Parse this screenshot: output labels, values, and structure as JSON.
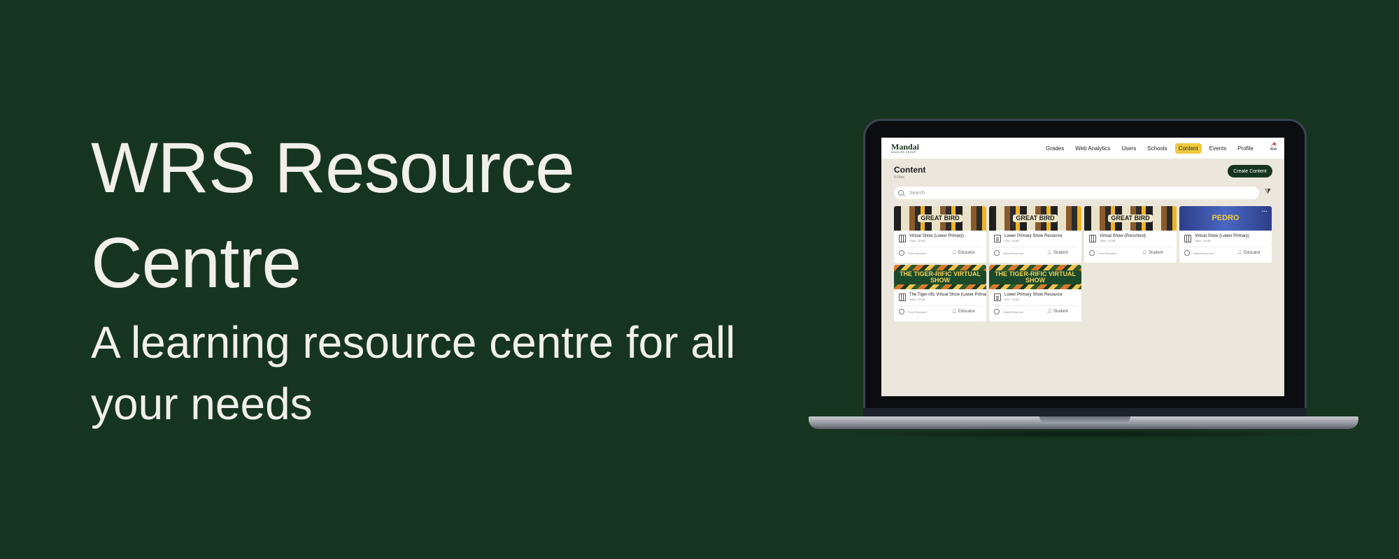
{
  "hero": {
    "title": "WRS Resource Centre",
    "subtitle": "A learning resource centre for all your needs"
  },
  "app": {
    "brand": {
      "name": "Mandai",
      "tagline": "WILDLIFE GROUP"
    },
    "nav": [
      "Grades",
      "Web Analytics",
      "Users",
      "Schools",
      "Content",
      "Events",
      "Profile"
    ],
    "nav_active": "Content",
    "page_title": "Content",
    "file_count": "6 Files",
    "create_button": "Create Content",
    "search_placeholder": "Search",
    "cards": [
      {
        "thumb": "bird",
        "thumb_text": "GREAT BIRD",
        "type": "video",
        "title": "Virtual Show (Lower Primary)",
        "meta": "Video • 25 MB",
        "tier": "Free Resource",
        "audience": "Educator"
      },
      {
        "thumb": "bird",
        "thumb_text": "GREAT BIRD",
        "type": "pdf",
        "title": "Lower Primary Show Resource",
        "meta": "PDF • 25 MB",
        "tier": "Gated Resource",
        "audience": "Student"
      },
      {
        "thumb": "bird",
        "thumb_text": "GREAT BIRD",
        "type": "video",
        "title": "Virtual Show (Preschool)",
        "meta": "Video • 25 MB",
        "tier": "Free Resource",
        "audience": "Student"
      },
      {
        "thumb": "pedro",
        "thumb_text": "PEDRO",
        "type": "video",
        "title": "Virtual Show (Lower Primary)",
        "meta": "Video • 25 MB",
        "tier": "Gated Resource",
        "audience": "Educator"
      },
      {
        "thumb": "tiger",
        "thumb_text": "THE TIGER-RIFIC VIRTUAL SHOW",
        "type": "video",
        "title": "The Tiger-rific Virtual Show (Lower Primary)",
        "meta": "Video • 25 MB",
        "tier": "Free Resource",
        "audience": "Educator"
      },
      {
        "thumb": "tiger",
        "thumb_text": "THE TIGER-RIFIC VIRTUAL SHOW",
        "type": "pdf",
        "title": "Lower Primary Show Resource",
        "meta": "PDF • 25 MB",
        "tier": "Gated Resource",
        "audience": "Student"
      }
    ]
  },
  "icons": {
    "search": "search-icon",
    "filter": "filter-icon",
    "bell": "bell-icon",
    "video": "film-icon",
    "pdf": "document-icon",
    "tier": "info-icon",
    "audience": "person-icon"
  },
  "colors": {
    "background": "#163520",
    "hero_text": "#f1efea",
    "app_background": "#ece7dc",
    "accent": "#f0c93c",
    "primary_button": "#163520"
  }
}
